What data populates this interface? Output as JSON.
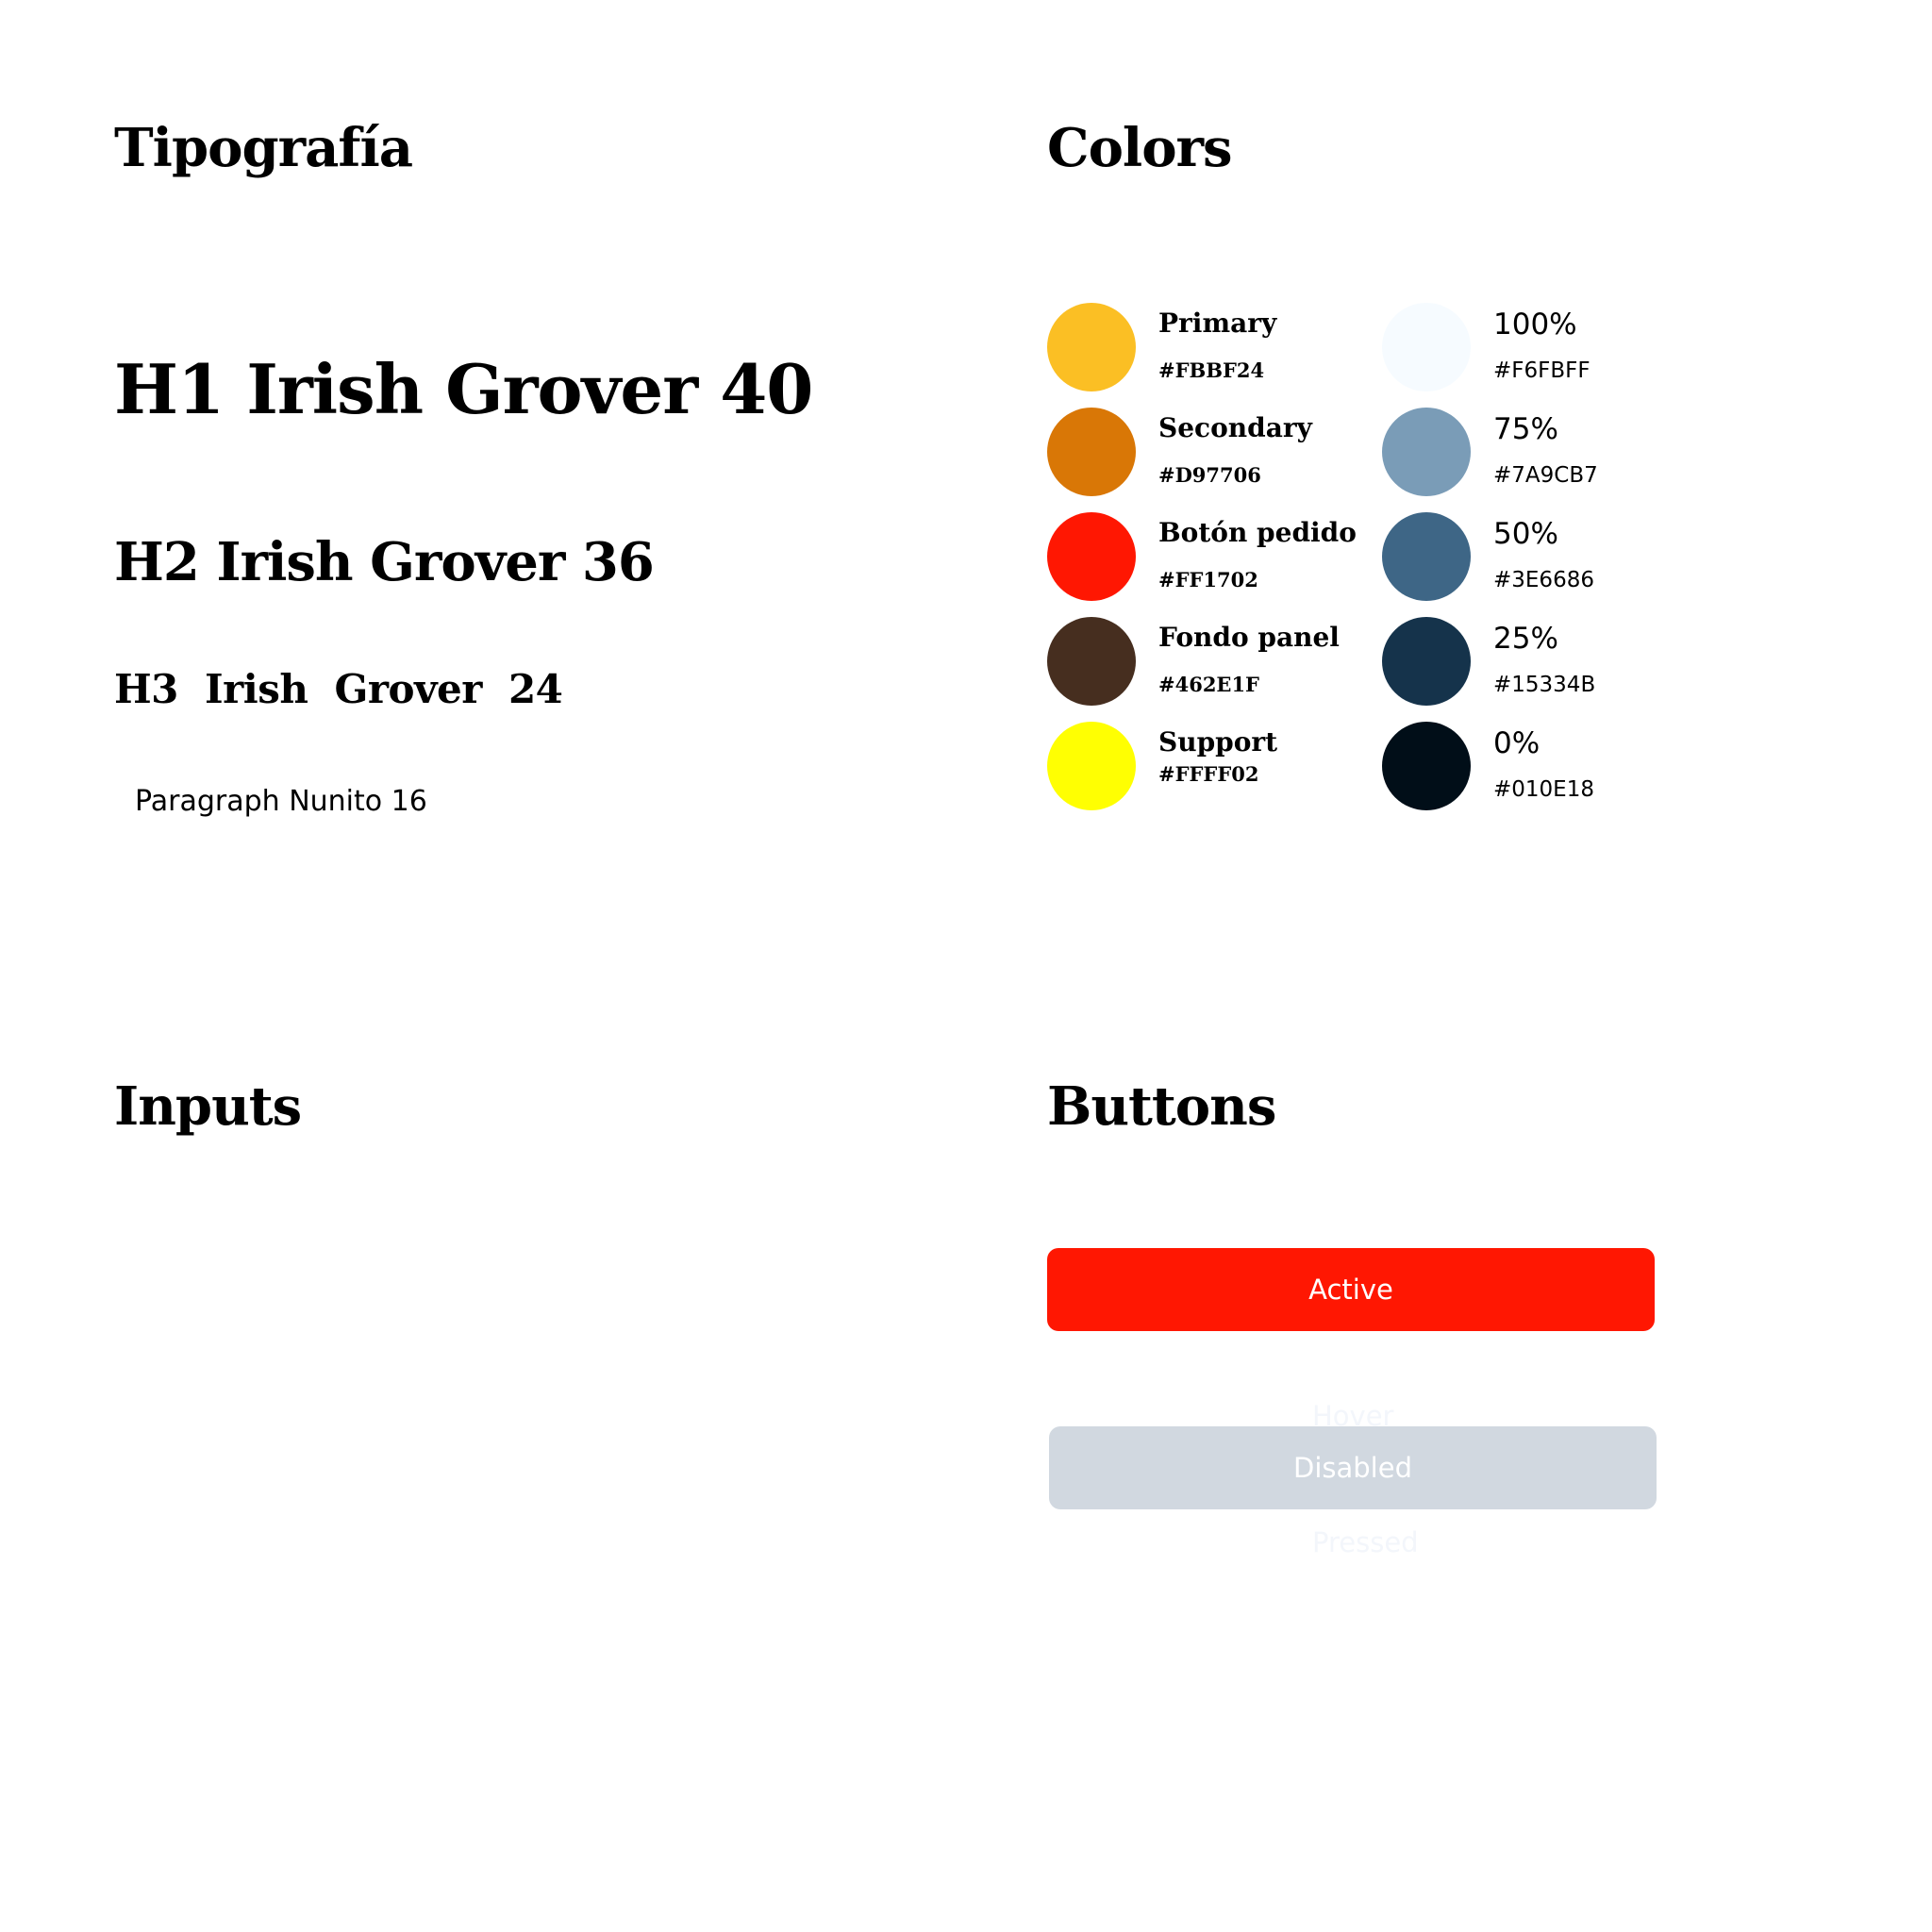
{
  "sections": {
    "typography": "Tipografía",
    "colors": "Colors",
    "inputs": "Inputs",
    "buttons": "Buttons"
  },
  "typography": {
    "h1": "H1 Irish Grover 40",
    "h2": "H2 Irish Grover 36",
    "h3": "H3  Irish Grover  24",
    "paragraph": "Paragraph Nunito 16"
  },
  "colors": {
    "brand": [
      {
        "name": "Primary",
        "hex": "#FBBF24",
        "color": "#FBBF24"
      },
      {
        "name": "Secondary",
        "hex": "#D97706",
        "color": "#D97706"
      },
      {
        "name": "Botón pedido",
        "hex": "#FF1702",
        "color": "#FF1702"
      },
      {
        "name": "Fondo panel",
        "hex": "#462E1F",
        "color": "#462E1F"
      },
      {
        "name": "Support",
        "hex": "#FFFF02",
        "color": "#FFFF02"
      }
    ],
    "scale": [
      {
        "name": "100%",
        "hex": "#F6FBFF",
        "color": "#F6FBFF"
      },
      {
        "name": "75%",
        "hex": "#7A9CB7",
        "color": "#7A9CB7"
      },
      {
        "name": "50%",
        "hex": "#3E6686",
        "color": "#3E6686"
      },
      {
        "name": "25%",
        "hex": "#15334B",
        "color": "#15334B"
      },
      {
        "name": "0%",
        "hex": "#010E18",
        "color": "#010E18"
      }
    ]
  },
  "buttons": {
    "active": {
      "label": "Active",
      "color": "#FF1702"
    },
    "hover": {
      "label": "Hover"
    },
    "disabled": {
      "label": "Disabled",
      "color": "#D1D8E0"
    },
    "pressed": {
      "label": "Pressed"
    }
  }
}
